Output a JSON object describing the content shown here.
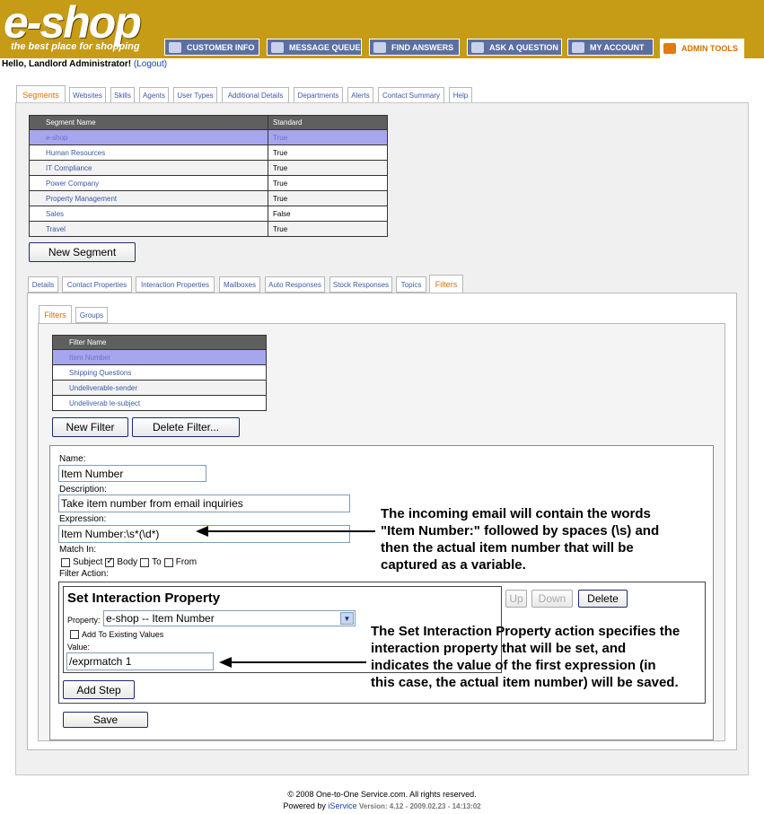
{
  "logo": {
    "main": "e-shop",
    "tagline": "the best place for shopping"
  },
  "topnav": [
    {
      "label": "CUSTOMER INFO",
      "icon": "people-icon"
    },
    {
      "label": "MESSAGE QUEUE",
      "icon": "queue-icon"
    },
    {
      "label": "FIND ANSWERS",
      "icon": "book-icon"
    },
    {
      "label": "ASK A QUESTION",
      "icon": "question-icon"
    },
    {
      "label": "MY ACCOUNT",
      "icon": "account-icon"
    },
    {
      "label": "ADMIN TOOLS",
      "icon": "wrench-icon"
    }
  ],
  "greeting": {
    "text": "Hello, Landlord Administrator!",
    "logout": "(Logout)"
  },
  "main_tabs": [
    "Segments",
    "Websites",
    "Skills",
    "Agents",
    "User Types",
    "Additional Details",
    "Departments",
    "Alerts",
    "Contact Summary",
    "Help"
  ],
  "segments_table": {
    "headers": [
      "Segment Name",
      "Standard"
    ],
    "rows": [
      [
        "e-shop",
        "True"
      ],
      [
        "Human Resources",
        "True"
      ],
      [
        "IT Compliance",
        "True"
      ],
      [
        "Power Company",
        "True"
      ],
      [
        "Property Management",
        "True"
      ],
      [
        "Sales",
        "False"
      ],
      [
        "Travel",
        "True"
      ]
    ]
  },
  "new_segment_label": "New Segment",
  "segment_tabs": [
    "Details",
    "Contact Properties",
    "Interaction Properties",
    "Mailboxes",
    "Auto Responses",
    "Stock Responses",
    "Topics",
    "Filters"
  ],
  "filter_tabs": [
    "Filters",
    "Groups"
  ],
  "filters_table": {
    "header": "Filter Name",
    "rows": [
      "Item Number",
      "Shipping Questions",
      "Undeliverable-sender",
      "Undeliverab le-subject"
    ]
  },
  "new_filter_label": "New Filter",
  "delete_filter_label": "Delete Filter...",
  "form": {
    "name_label": "Name:",
    "name_value": "Item Number",
    "description_label": "Description:",
    "description_value": "Take item number from email inquiries",
    "expression_label": "Expression:",
    "expression_value": "Item Number:\\s*(\\d*)",
    "match_in_label": "Match In:",
    "match_subject": "Subject",
    "match_body": "Body",
    "match_to": "To",
    "match_from": "From",
    "filter_action_label": "Filter Action:"
  },
  "action": {
    "title": "Set Interaction Property",
    "property_label": "Property:",
    "property_value": "e-shop -- Item Number",
    "add_existing_label": "Add To Existing Values",
    "value_label": "Value:",
    "value_value": "/exprmatch 1",
    "up_label": "Up",
    "down_label": "Down",
    "delete_label": "Delete",
    "add_step_label": "Add Step",
    "save_label": "Save"
  },
  "notes": {
    "expression_note": "The incoming email will contain the words \"Item Number:\" followed by spaces (\\s) and then the actual item number that will be captured as a variable.",
    "action_note": "The Set Interaction Property action specifies the interaction property that will be set, and indicates the value of the first expression (in this case, the actual item number) will be saved."
  },
  "footer": {
    "copyright": "© 2008 One-to-One Service.com. All rights reserved.",
    "powered_by": "Powered by",
    "brand": "iService",
    "version": "Version: 4.12 - 2009.02.23 - 14:13:02"
  },
  "colors": {
    "header": "#c69c16",
    "nav": "#5b6fa3",
    "active_tab": "#d96e00",
    "link": "#3b5aa8",
    "selected_row": "#a6a6ee"
  }
}
